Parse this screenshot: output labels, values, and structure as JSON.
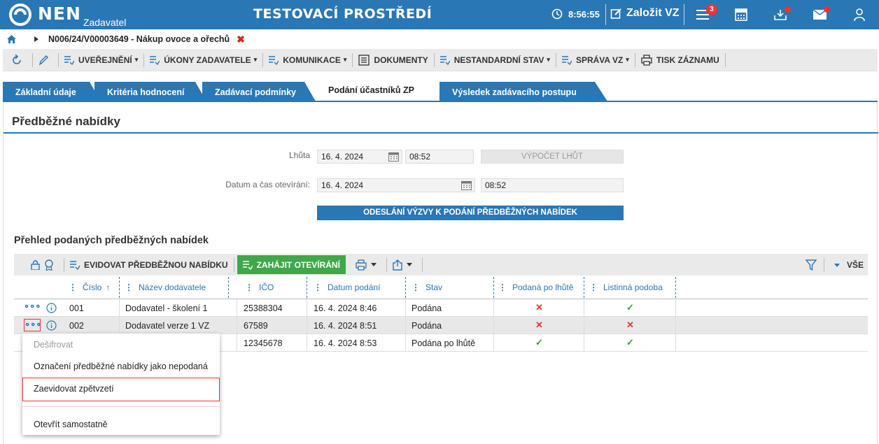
{
  "app": {
    "logo_text": "NEN",
    "logo_sub": "Zadavatel",
    "environment": "TESTOVACÍ PROSTŘEDÍ",
    "clock": "8:56:55",
    "create_label": "Založit VZ",
    "tasks_badge": "3",
    "accent_color": "#2a77b5"
  },
  "breadcrumb": {
    "text": "N006/24/V00003649 - Nákup ovoce a ořechů",
    "close": "✖"
  },
  "actions": [
    {
      "label": "UVEŘEJNĚNÍ",
      "caret": "▾"
    },
    {
      "label": "ÚKONY ZADAVATELE",
      "caret": "▾"
    },
    {
      "label": "KOMUNIKACE",
      "caret": "▾"
    },
    {
      "label": "DOKUMENTY",
      "caret": ""
    },
    {
      "label": "NESTANDARDNÍ STAV",
      "caret": "▾"
    },
    {
      "label": "SPRÁVA VZ",
      "caret": "▾"
    },
    {
      "label": "TISK ZÁZNAMU",
      "caret": ""
    }
  ],
  "tabs": [
    {
      "label": "Základní údaje"
    },
    {
      "label": "Kritéria hodnocení"
    },
    {
      "label": "Zadávací podmínky"
    },
    {
      "label": "Podání účastníků ZP"
    },
    {
      "label": "Výsledek zadávacího postupu"
    }
  ],
  "section": {
    "title": "Předběžné nabídky",
    "deadline_label": "Lhůta",
    "deadline_date": "16. 4. 2024",
    "deadline_time": "08:52",
    "calc_button": "VÝPOČET LHŮT",
    "open_label": "Datum a čas otevírání:",
    "open_date": "16. 4. 2024",
    "open_time": "08:52",
    "send_button": "ODESLÁNÍ VÝZVY K PODÁNÍ PŘEDBĚŽNÝCH NABÍDEK"
  },
  "grid": {
    "title": "Přehled podaných předběžných nabídek",
    "toolbar": {
      "add_label": "EVIDOVAT PŘEDBĚŽNOU NABÍDKU",
      "open_label": "ZAHÁJIT OTEVÍRÁNÍ",
      "filter_all": "VŠE"
    },
    "columns": {
      "cislo": "Číslo",
      "sort_arrow": "↑",
      "nazev": "Název dodavatele",
      "ico": "IČO",
      "datum": "Datum podání",
      "stav": "Stav",
      "po_lhute": "Podaná po lhůtě",
      "listinna": "Listinná podoba"
    },
    "rows": [
      {
        "cislo": "001",
        "nazev": "Dodavatel - školení 1",
        "ico": "25388304",
        "datum": "16. 4. 2024 8:46",
        "stav": "Podána",
        "po_lhute": "✕",
        "listinna": "✓"
      },
      {
        "cislo": "002",
        "nazev": "Dodavatel verze 1 VZ",
        "ico": "67589",
        "datum": "16. 4. 2024 8:51",
        "stav": "Podána",
        "po_lhute": "✕",
        "listinna": "✕"
      },
      {
        "cislo": "",
        "nazev": "",
        "ico": "12345678",
        "datum": "16. 4. 2024 8:53",
        "stav": "Podána po lhůtě",
        "po_lhute": "✓",
        "listinna": "✓"
      }
    ],
    "row_menu_glyph": "∘∘∘"
  },
  "context_menu": {
    "items": [
      {
        "label": "Dešifrovat"
      },
      {
        "label": "Označení předběžné nabídky jako nepodaná"
      },
      {
        "label": "Zaevidovat zpětvzetí"
      },
      {
        "label": "Otevřít samostatně"
      }
    ]
  }
}
